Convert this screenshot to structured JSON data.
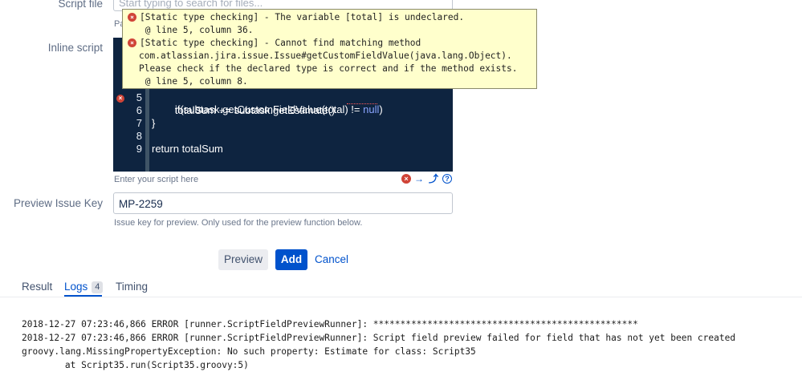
{
  "form": {
    "script_file_label": "Script file",
    "script_file_placeholder": "Start typing to search for files...",
    "script_file_hint_partial": "Pa",
    "inline_script_label": "Inline script",
    "inline_script_hint": "Enter your script here",
    "preview_key_label": "Preview Issue Key",
    "preview_key_value": "MP-2259",
    "preview_key_hint": "Issue key for preview. Only used for the preview function below."
  },
  "editor": {
    "lines": [
      {
        "num": "5",
        "code_pre": "    if(subtask.getCustomFieldValue(total) != ",
        "code_null": "null",
        "code_post": ")",
        "error": true
      },
      {
        "num": "6",
        "code": "        totalSum += subtask.getEstimate()"
      },
      {
        "num": "7",
        "code": "}"
      },
      {
        "num": "8",
        "code": ""
      },
      {
        "num": "9",
        "code": "return totalSum"
      }
    ],
    "error_mark": "×"
  },
  "tooltip": {
    "lines": [
      "[Static type checking] - The variable [total] is undeclared.",
      " @ line 5, column 36.",
      "[Static type checking] - Cannot find matching method",
      "com.atlassian.jira.issue.Issue#getCustomFieldValue(java.lang.Object).",
      "Please check if the declared type is correct and if the method exists.",
      " @ line 5, column 8."
    ],
    "error_icon": "×"
  },
  "editor_controls": {
    "error_icon": "×",
    "next_icon": "→",
    "jump_icon": "⤴",
    "help_icon": "?"
  },
  "buttons": {
    "preview": "Preview",
    "add": "Add",
    "cancel": "Cancel"
  },
  "tabs": {
    "result": "Result",
    "logs": "Logs",
    "logs_count": "4",
    "timing": "Timing"
  },
  "logs": [
    "2018-12-27 07:23:46,866 ERROR [runner.ScriptFieldPreviewRunner]: *************************************************",
    "2018-12-27 07:23:46,866 ERROR [runner.ScriptFieldPreviewRunner]: Script field preview failed for field that has not yet been created",
    "groovy.lang.MissingPropertyException: No such property: Estimate for class: Script35",
    "        at Script35.run(Script35.groovy:5)"
  ]
}
